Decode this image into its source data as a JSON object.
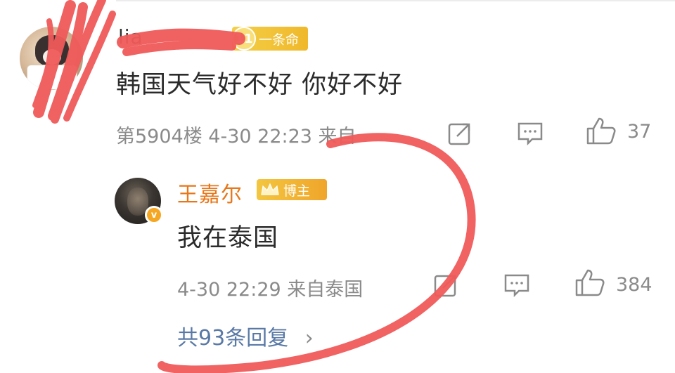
{
  "comment_main": {
    "username": "lia",
    "level_number": "11",
    "badge_label": "一条命",
    "text": "韩国天气好不好 你好不好",
    "meta": "第5904楼 4-30 22:23 来自",
    "like_count": "37"
  },
  "reply": {
    "username": "王嘉尔",
    "badge_label": "博主",
    "text": "我在泰国",
    "meta": "4-30 22:29 来自泰国",
    "like_count": "384",
    "more_replies": "共93条回复",
    "more_arrow": "›"
  },
  "icons": [
    "share-icon",
    "comment-icon",
    "like-icon",
    "verified-icon",
    "crown-icon"
  ],
  "colors": {
    "username_highlight": "#e8771a",
    "meta_gray": "#8a8a8a",
    "link_blue": "#5a7aa6",
    "badge_gold": "#f0b82b",
    "scribble_red": "#f05a5a"
  }
}
